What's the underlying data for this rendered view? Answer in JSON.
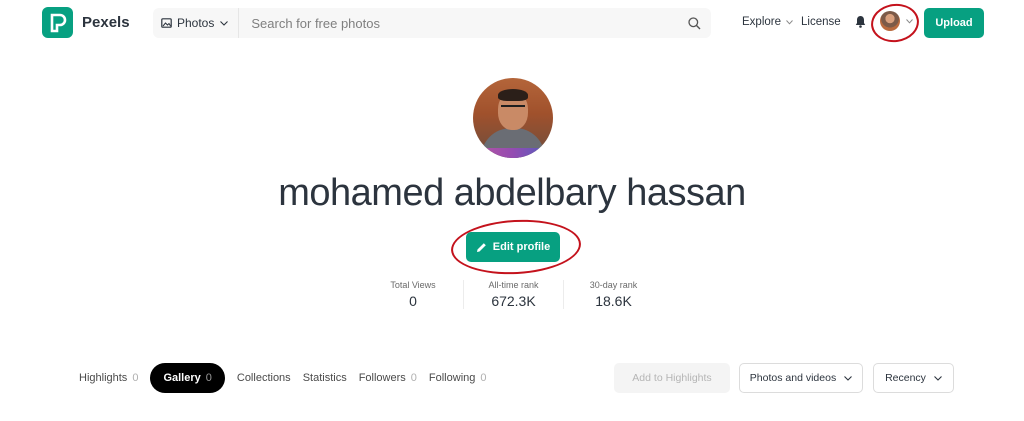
{
  "header": {
    "brand": "Pexels",
    "search": {
      "type_label": "Photos",
      "placeholder": "Search for free photos"
    },
    "nav": {
      "explore": "Explore",
      "license": "License"
    },
    "upload_label": "Upload"
  },
  "profile": {
    "name": "mohamed abdelbary hassan",
    "edit_label": "Edit profile",
    "stats": [
      {
        "label": "Total Views",
        "value": "0"
      },
      {
        "label": "All-time rank",
        "value": "672.3K"
      },
      {
        "label": "30-day rank",
        "value": "18.6K"
      }
    ]
  },
  "tabs": [
    {
      "label": "Highlights",
      "count": "0",
      "active": false
    },
    {
      "label": "Gallery",
      "count": "0",
      "active": true
    },
    {
      "label": "Collections",
      "count": "",
      "active": false
    },
    {
      "label": "Statistics",
      "count": "",
      "active": false
    },
    {
      "label": "Followers",
      "count": "0",
      "active": false
    },
    {
      "label": "Following",
      "count": "0",
      "active": false
    }
  ],
  "toolbar": {
    "add_highlights": "Add to Highlights",
    "media_filter": "Photos and videos",
    "sort": "Recency"
  },
  "colors": {
    "accent": "#07a081",
    "annotation": "#c4121c"
  }
}
